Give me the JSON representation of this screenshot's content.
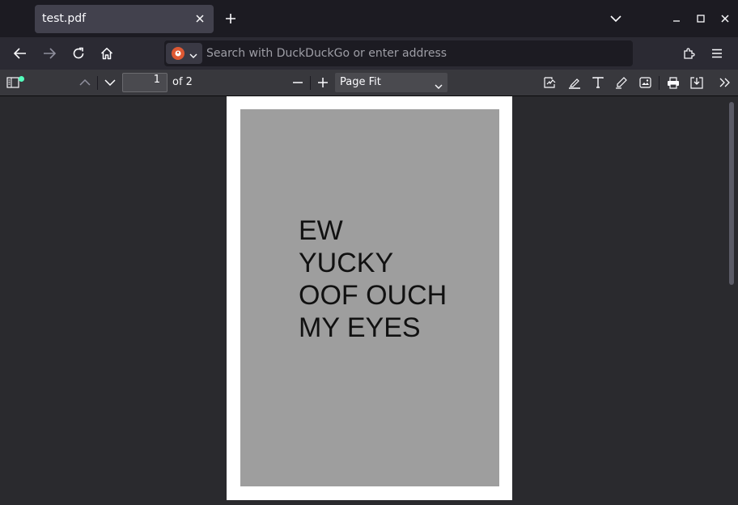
{
  "browser": {
    "tab": {
      "title": "test.pdf"
    },
    "urlbar": {
      "placeholder": "Search with DuckDuckGo or enter address"
    },
    "icons": [
      "close-icon",
      "plus-icon",
      "chevron-down-icon",
      "minimize-icon",
      "maximize-icon",
      "back-icon",
      "forward-icon",
      "reload-icon",
      "home-icon",
      "extensions-icon",
      "menu-icon"
    ]
  },
  "pdf_toolbar": {
    "page_number": "1",
    "page_count": "of 2",
    "zoom": "Page Fit",
    "icons": [
      "sidebar-toggle-icon",
      "chevron-up-icon",
      "chevron-down-icon",
      "zoom-out-icon",
      "zoom-in-icon",
      "signature-icon",
      "highlight-icon",
      "text-icon",
      "draw-icon",
      "image-icon",
      "print-icon",
      "save-icon",
      "more-tools-icon"
    ]
  },
  "document": {
    "lines": [
      "EW",
      "YUCKY",
      "OOF OUCH",
      "MY EYES"
    ]
  },
  "colors": {
    "tabbar": "#1c1b22",
    "toolbar": "#2b2a33",
    "pdf_toolbar": "#38383d",
    "viewer": "#2a2a2e",
    "page_fill": "#9e9e9e",
    "notification_dot": "#54ffbd"
  }
}
